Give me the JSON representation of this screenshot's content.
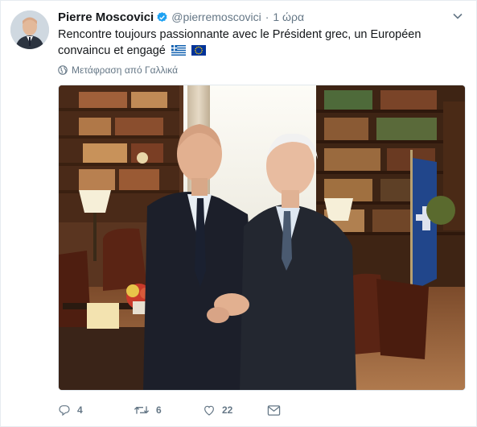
{
  "tweet": {
    "author_name": "Pierre Moscovici",
    "handle": "@pierremoscovici",
    "separator": "·",
    "time": "1 ώρα",
    "text": "Rencontre toujours passionnante avec le Président grec, un Européen convaincu et engagé",
    "flags": [
      "greece-flag-icon",
      "eu-flag-icon"
    ],
    "translate_label": "Μετάφραση από Γαλλικά"
  },
  "actions": {
    "reply_count": "4",
    "retweet_count": "6",
    "like_count": "22"
  },
  "colors": {
    "accent": "#1da1f2",
    "muted": "#657786",
    "text": "#14171a",
    "border": "#e6ecf0"
  }
}
